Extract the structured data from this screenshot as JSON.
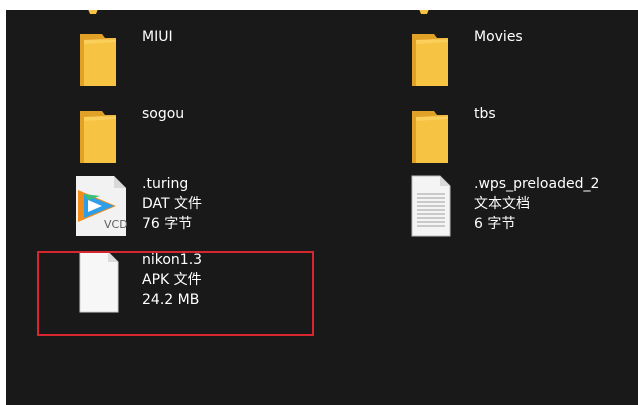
{
  "items": [
    {
      "name": "MIUI",
      "icon": "folder-icon"
    },
    {
      "name": "Movies",
      "icon": "folder-icon"
    },
    {
      "name": "sogou",
      "icon": "folder-icon"
    },
    {
      "name": "tbs",
      "icon": "folder-icon"
    },
    {
      "name": ".turing",
      "type": "DAT 文件",
      "size": "76 字节",
      "icon": "tencent-video-icon",
      "overlay_text": "VCD"
    },
    {
      "name": ".wps_preloaded_2",
      "type": "文本文档",
      "size": "6 字节",
      "icon": "text-document-icon"
    },
    {
      "name": "nikon1.3",
      "type": "APK 文件",
      "size": "24.2 MB",
      "icon": "blank-file-icon"
    }
  ],
  "colors": {
    "background": "#191919",
    "text": "#ffffff",
    "folder": "#f6c343",
    "selection": "#d8262f"
  }
}
